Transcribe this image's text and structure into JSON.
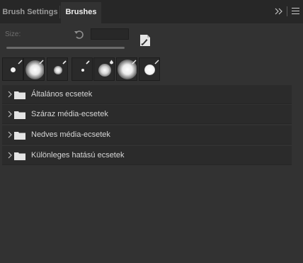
{
  "tabs": [
    {
      "label": "Brush Settings",
      "active": false
    },
    {
      "label": "Brushes",
      "active": true
    }
  ],
  "toolbar": {
    "collapse_icon": "double-chevron-right-icon",
    "menu_icon": "hamburger-menu-icon"
  },
  "size": {
    "label": "Size:",
    "value": "",
    "reset_icon": "reset-arrow-icon",
    "new_brush_icon": "new-brush-icon"
  },
  "presets": [
    {
      "icon": "brush-tool-icon",
      "shape": "hard-round"
    },
    {
      "icon": "brush-tool-icon",
      "shape": "soft-round-large"
    },
    {
      "icon": "pencil-tool-icon",
      "shape": "soft-round-small"
    },
    {
      "icon": "pencil-tool-icon",
      "shape": "hard-round-tiny"
    },
    {
      "icon": "blend-tool-icon",
      "shape": "soft-round-medium"
    },
    {
      "icon": "brush-tool-icon",
      "shape": "soft-round-large"
    },
    {
      "icon": "brush-tool-icon",
      "shape": "hard-round-medium"
    }
  ],
  "groups": [
    {
      "label": "Általános ecsetek",
      "icon": "folder-icon"
    },
    {
      "label": "Száraz média-ecsetek",
      "icon": "folder-icon"
    },
    {
      "label": "Nedves média-ecsetek",
      "icon": "folder-icon"
    },
    {
      "label": "Különleges hatású ecsetek",
      "icon": "folder-icon"
    }
  ],
  "colors": {
    "panel": "#323232",
    "tabbar": "#272727",
    "row": "#2b2b2b"
  }
}
